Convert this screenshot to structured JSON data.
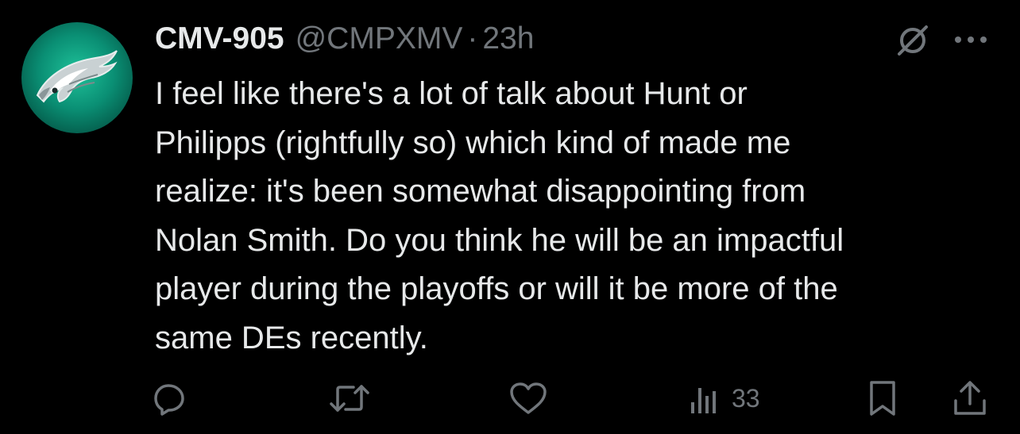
{
  "tweet": {
    "display_name": "CMV-905",
    "handle": "@CMPXMV",
    "separator": "·",
    "time": "23h",
    "text": "I feel like there's a lot of talk about Hunt or\nPhilipps (rightfully so) which kind of made me\nrealize: it's been somewhat disappointing from\nNolan Smith. Do you think he will be an impactful\nplayer during the playoffs or will it be more of the\nsame DEs recently."
  },
  "actions": {
    "reply_icon": "reply-icon",
    "retweet_icon": "retweet-icon",
    "like_icon": "heart-icon",
    "views_icon": "views-bar-icon",
    "views_count": "33",
    "bookmark_icon": "bookmark-icon",
    "share_icon": "share-icon"
  },
  "colors": {
    "background": "#000000",
    "primary_text": "#e7e9ea",
    "secondary_text": "#71767b",
    "avatar_green": "#0a8f74"
  }
}
